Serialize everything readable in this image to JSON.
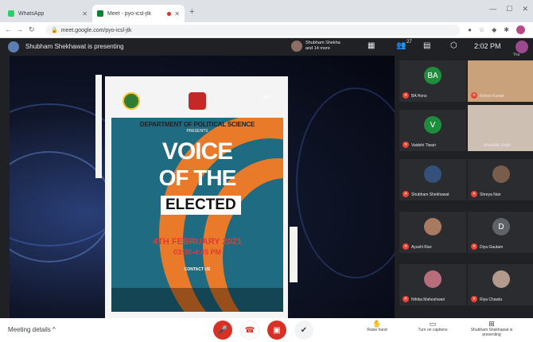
{
  "browser": {
    "tabs": [
      {
        "title": "WhatsApp",
        "favicon_color": "#25d366"
      },
      {
        "title": "Meet - pyo-icsl-jtk",
        "favicon_color": "#00832d"
      }
    ],
    "new_tab": "+",
    "url": "meet.google.com/pyo-icsl-jtk"
  },
  "meet": {
    "presenting_text": "Shubham Shekhawat is presenting",
    "host_name": "Shubham Shekha and 14 more",
    "participant_count": "27",
    "time": "2:02 PM",
    "me_label": "You"
  },
  "poster": {
    "department": "DEPARTMENT OF POLITICAL SCIENCE",
    "presents": "PRESENTS",
    "title_line1": "VOICE",
    "title_line2": "OF THE",
    "title_line3": "ELECTED",
    "date": "4TH FEBRUARY 2021",
    "time": "03:30-4:45 PM",
    "contact": "CONTACT US",
    "edition": "11th"
  },
  "participants": [
    {
      "name": "BA Hons",
      "initials": "BA",
      "color": "#1e8e3e",
      "video": false
    },
    {
      "name": "Rohan Kumar",
      "initials": "",
      "color": "#c9a27c",
      "video": true
    },
    {
      "name": "Vaidehi Tiwari",
      "initials": "V",
      "color": "#1e8e3e",
      "video": false
    },
    {
      "name": "Anandita Singh",
      "initials": "",
      "color": "#c8b8a8",
      "video": true
    },
    {
      "name": "Shubham Shekhawat",
      "initials": "",
      "color": "#33517a",
      "video": false
    },
    {
      "name": "Shreya Nair",
      "initials": "",
      "color": "#7a5c4a",
      "video": false
    },
    {
      "name": "Ayushi Rao",
      "initials": "",
      "color": "#a87a60",
      "video": false
    },
    {
      "name": "Diya Gautam",
      "initials": "D",
      "color": "#5f6368",
      "video": false
    },
    {
      "name": "Nihika Maheshwari",
      "initials": "",
      "color": "#b86d7a",
      "video": false
    },
    {
      "name": "Riya Chawla",
      "initials": "",
      "color": "#b39a8c",
      "video": false
    }
  ],
  "bottom": {
    "meeting_details": "Meeting details",
    "raise_hand": "Raise hand",
    "captions": "Turn on captions",
    "presenting": "Shubham Shekhawat is presenting"
  }
}
